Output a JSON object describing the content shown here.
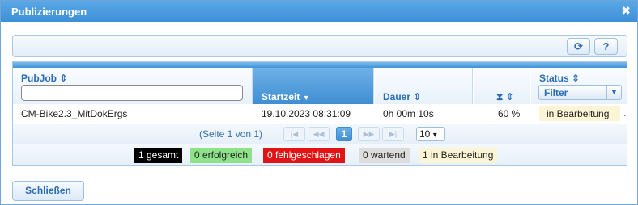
{
  "dialog": {
    "title": "Publizierungen",
    "close_glyph": "✖"
  },
  "toolbar": {
    "refresh_glyph": "⟳",
    "help_label": "?"
  },
  "table": {
    "columns": {
      "pubjob": "PubJob",
      "startzeit": "Startzeit",
      "dauer": "Dauer",
      "progress_icon": "⧗",
      "status": "Status"
    },
    "sort_glyph": "⇕",
    "sorted_desc_glyph": "▼",
    "pubjob_filter_value": "",
    "status_filter": {
      "value": "Filter",
      "chevron": "▼"
    },
    "rows": [
      {
        "pubjob": "CM-Bike2.3_MitDokErgs",
        "startzeit": "19.10.2023 08:31:09",
        "dauer": "0h 00m 10s",
        "progress": "60 %",
        "status": "in Bearbeitung",
        "overflow": "."
      }
    ]
  },
  "pager": {
    "info": "(Seite 1 von 1)",
    "first": "|◀",
    "prev": "◀◀",
    "current_page": "1",
    "next": "▶▶",
    "last": "▶|",
    "page_size": "10",
    "page_size_chevron": "▾"
  },
  "summary": {
    "gesamt": "1 gesamt",
    "erfolgreich": "0 erfolgreich",
    "fehlgeschlagen": "0 fehlgeschlagen",
    "wartend": "0 wartend",
    "in_bearbeitung": "1 in Bearbeitung"
  },
  "colors": {
    "title_bar": "#3d8fd6",
    "gesamt": "#000000",
    "erfolgreich": "#8ee28a",
    "fehlgeschlagen": "#e01414",
    "wartend": "#dddddd",
    "in_bearbeitung": "#fbf5d6"
  },
  "footer": {
    "close_label": "Schließen"
  }
}
